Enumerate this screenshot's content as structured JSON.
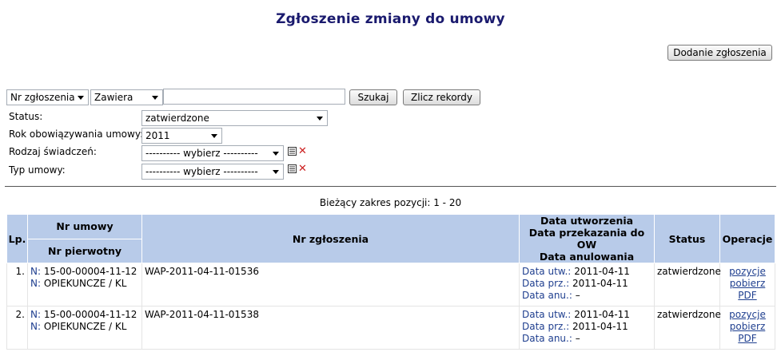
{
  "page": {
    "title": "Zgłoszenie zmiany do umowy",
    "add_button": "Dodanie zgłoszenia"
  },
  "filters": {
    "field_select": "Nr zgłoszenia",
    "op_select": "Zawiera",
    "search_value": "",
    "search_button": "Szukaj",
    "count_button": "Zlicz rekordy",
    "status_label": "Status:",
    "status_value": "zatwierdzone",
    "year_label": "Rok obowiązywania umowy:",
    "year_value": "2011",
    "benefit_label": "Rodzaj świadczeń:",
    "benefit_value": "---------- wybierz ----------",
    "contract_type_label": "Typ umowy:",
    "contract_type_value": "---------- wybierz ----------"
  },
  "range_text": "Bieżący zakres pozycji: 1 - 20",
  "table": {
    "headers": {
      "lp": "Lp.",
      "nr_umowy": "Nr umowy",
      "nr_pierwotny": "Nr pierwotny",
      "nr_zgloszenia": "Nr zgłoszenia",
      "date1": "Data utworzenia",
      "date2": "Data przekazania do OW",
      "date3": "Data anulowania",
      "status": "Status",
      "operacje": "Operacje"
    },
    "rows": [
      {
        "lp": "1.",
        "n_prefix": "N:",
        "nr_umowy": "15-00-00004-11-12",
        "nr_pierwotny": "OPIEKUNCZE / KL",
        "nr_zgloszenia": "WAP-2011-04-11-01536",
        "utw_label": "Data utw.:",
        "utw": "2011-04-11",
        "prz_label": "Data prz.:",
        "prz": "2011-04-11",
        "anu_label": "Data anu.:",
        "anu": "–",
        "status": "zatwierdzone",
        "op1": "pozycje",
        "op2": "pobierz",
        "op3": "PDF"
      },
      {
        "lp": "2.",
        "n_prefix": "N:",
        "nr_umowy": "15-00-00004-11-12",
        "nr_pierwotny": "OPIEKUNCZE / KL",
        "nr_zgloszenia": "WAP-2011-04-11-01538",
        "utw_label": "Data utw.:",
        "utw": "2011-04-11",
        "prz_label": "Data prz.:",
        "prz": "2011-04-11",
        "anu_label": "Data anu.:",
        "anu": "–",
        "status": "zatwierdzone",
        "op1": "pozycje",
        "op2": "pobierz",
        "op3": "PDF"
      }
    ]
  },
  "colors": {
    "title": "#1a1a6e",
    "header_bg": "#b8cbe9",
    "link": "#1f3f8f",
    "clear_icon": "#cc1f1f"
  },
  "icons": [
    "list-icon",
    "clear-icon",
    "dropdown-arrow-icon"
  ]
}
